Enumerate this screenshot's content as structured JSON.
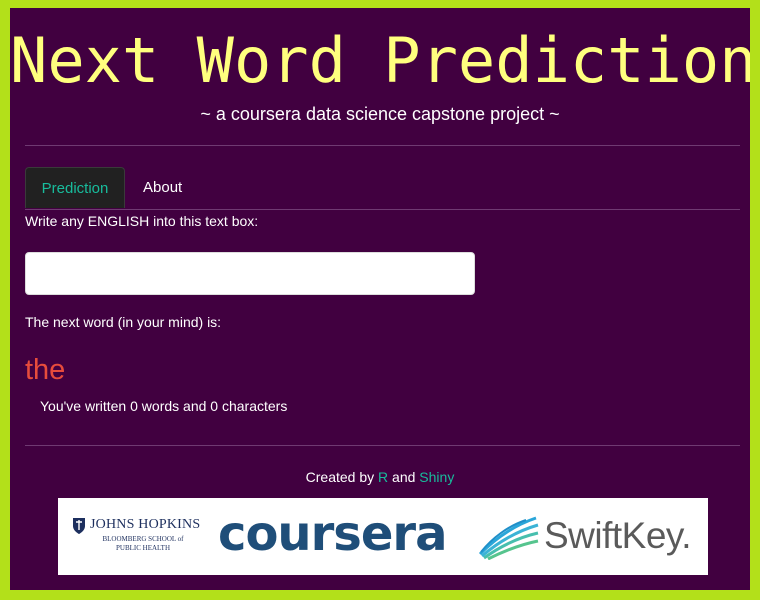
{
  "header": {
    "title": "Next Word Prediction",
    "subtitle": "~ a coursera data science capstone project ~"
  },
  "tabs": [
    {
      "label": "Prediction",
      "active": true
    },
    {
      "label": "About",
      "active": false
    }
  ],
  "prediction_tab": {
    "input_label": "Write any ENGLISH into this text box:",
    "input_value": "",
    "output_label": "The next word (in your mind) is:",
    "predicted_word": "the",
    "counts_prefix": "You've written ",
    "word_count": "0",
    "counts_mid": " words and ",
    "char_count": "0",
    "counts_suffix": " characters"
  },
  "footer": {
    "created_by": "Created by ",
    "link_r": "R",
    "and": " and ",
    "link_shiny": "Shiny"
  },
  "logos": {
    "jhu_name": "JOHNS HOPKINS",
    "jhu_sub": "BLOOMBERG SCHOOL of PUBLIC HEALTH",
    "coursera": "coursera",
    "swiftkey": "SwiftKey."
  },
  "colors": {
    "page_background": "#410040",
    "frame_border": "#b3e01a",
    "title": "#ffff7e",
    "accent": "#18bc9c",
    "prediction": "#e74c3c"
  }
}
